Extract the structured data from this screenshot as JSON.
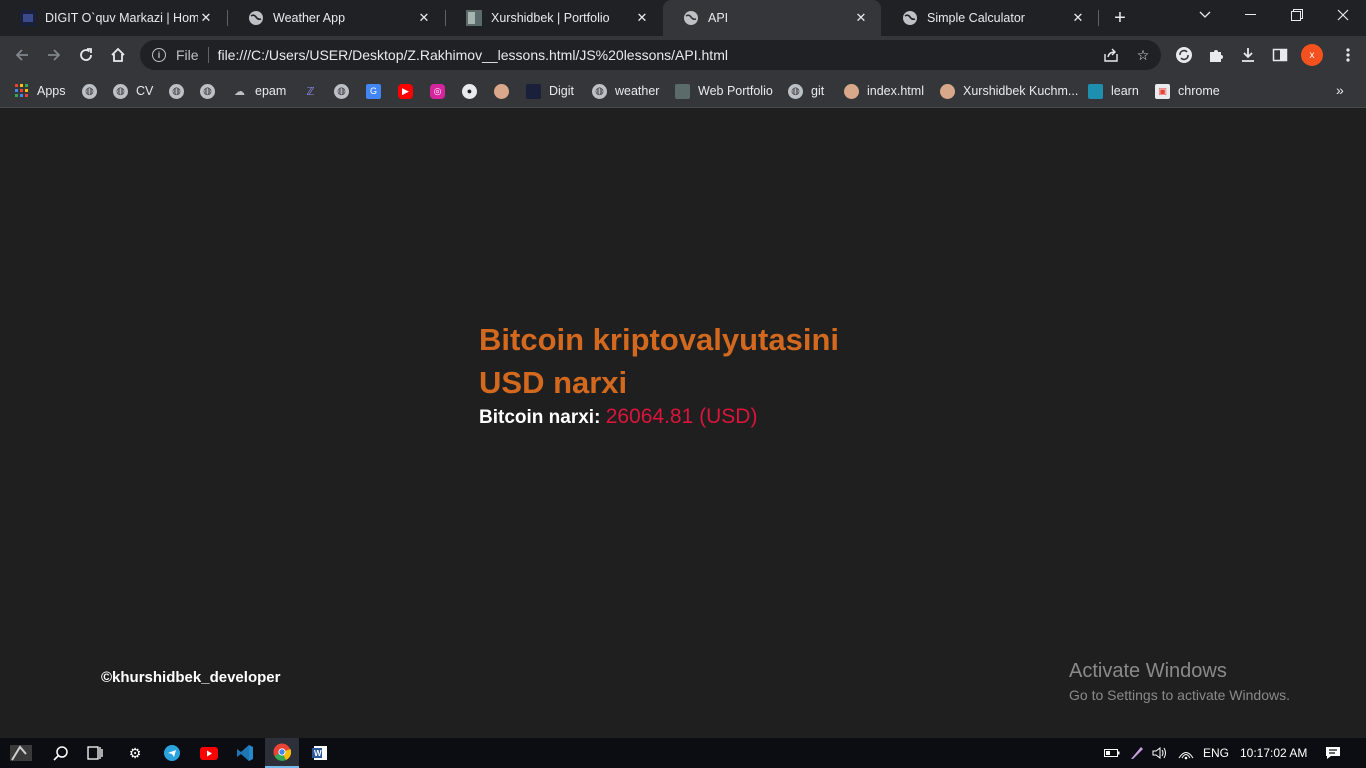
{
  "tabs": [
    {
      "title": "DIGIT O`quv Markazi | Home",
      "icon": "digit-favicon",
      "active": false
    },
    {
      "title": "Weather App",
      "icon": "globe-icon",
      "active": false
    },
    {
      "title": "Xurshidbek | Portfolio",
      "icon": "portfolio-favicon",
      "active": false
    },
    {
      "title": "API",
      "icon": "globe-icon",
      "active": true
    },
    {
      "title": "Simple Calculator",
      "icon": "globe-icon",
      "active": false
    }
  ],
  "toolbar": {
    "scheme": "File",
    "url": "file:///C:/Users/USER/Desktop/Z.Rakhimov__lessons.html/JS%20lessons/API.html",
    "profile_initial": "x"
  },
  "bookmarks": [
    {
      "label": "Apps",
      "icon": "apps-grid-icon"
    },
    {
      "label": "",
      "icon": "globe-icon"
    },
    {
      "label": "CV",
      "icon": "globe-icon"
    },
    {
      "label": "",
      "icon": "globe-icon"
    },
    {
      "label": "",
      "icon": "globe-icon"
    },
    {
      "label": "epam",
      "icon": "epam-icon"
    },
    {
      "label": "",
      "icon": "z-icon"
    },
    {
      "label": "",
      "icon": "globe-icon"
    },
    {
      "label": "",
      "icon": "translate-icon"
    },
    {
      "label": "",
      "icon": "youtube-icon"
    },
    {
      "label": "",
      "icon": "instagram-icon"
    },
    {
      "label": "",
      "icon": "github-icon"
    },
    {
      "label": "",
      "icon": "avatar-icon"
    },
    {
      "label": "Digit",
      "icon": "digit-favicon"
    },
    {
      "label": "weather",
      "icon": "globe-icon"
    },
    {
      "label": "Web Portfolio",
      "icon": "portfolio-favicon"
    },
    {
      "label": "git",
      "icon": "globe-icon"
    },
    {
      "label": "index.html",
      "icon": "avatar-icon"
    },
    {
      "label": "Xurshidbek Kuchm...",
      "icon": "avatar-icon"
    },
    {
      "label": "learn",
      "icon": "learn-icon"
    },
    {
      "label": "chrome",
      "icon": "chrome-store-icon"
    }
  ],
  "page": {
    "heading": "Bitcoin kriptovalyutasini USD narxi",
    "price_label": "Bitcoin narxi:",
    "price_value": "26064.81 (USD)",
    "credit": "©khurshidbek_developer",
    "activate_title": "Activate Windows",
    "activate_subtitle": "Go to Settings to activate Windows."
  },
  "taskbar": {
    "language": "ENG",
    "time": "10:17:02 AM"
  },
  "colors": {
    "heading": "#d2691e",
    "price_value": "#dc143c",
    "page_background": "#1f1f1f",
    "profile_accent": "#f4511e"
  }
}
